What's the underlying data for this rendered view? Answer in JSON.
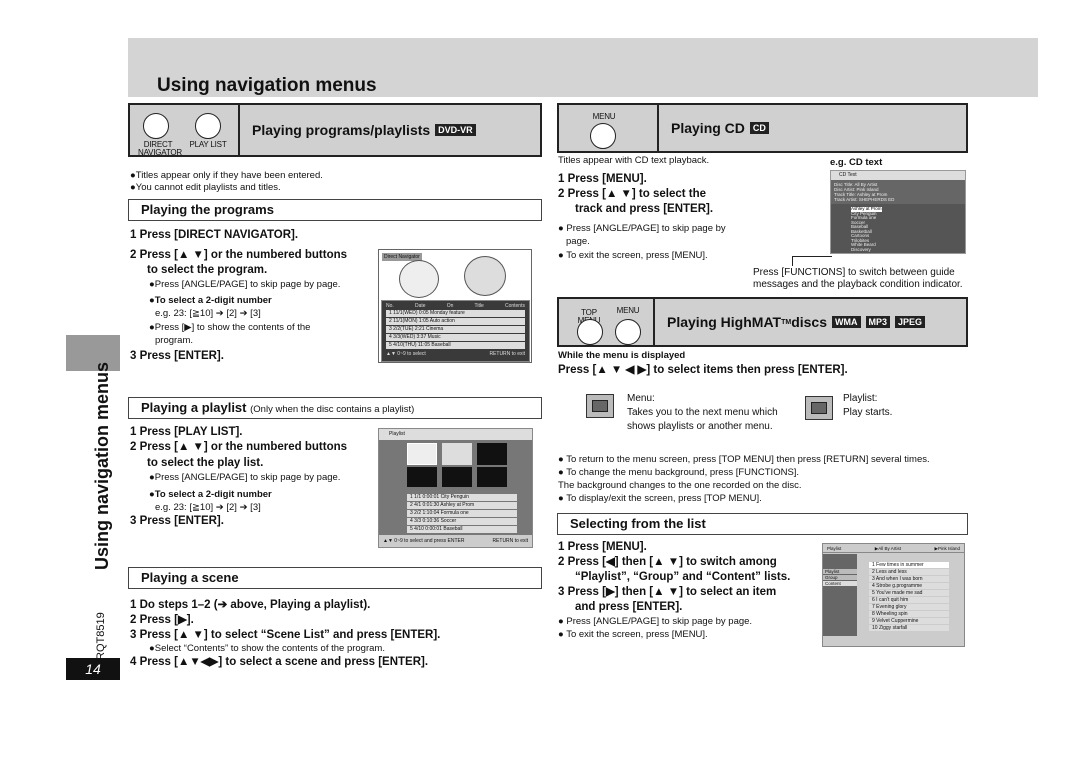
{
  "page": {
    "title": "Using navigation menus",
    "side_label": "Using navigation menus",
    "doc_code": "RQT8519",
    "page_number": "14"
  },
  "programs": {
    "header": "Playing programs/playlists",
    "tag": "DVD-VR",
    "btn1": "DIRECT NAVIGATOR",
    "btn2": "PLAY LIST",
    "notes": [
      "●Titles appear only if they have been entered.",
      "●You cannot edit playlists and titles."
    ],
    "sub": "Playing the programs",
    "step1": "1   Press [DIRECT NAVIGATOR].",
    "step2a": "2   Press [▲ ▼] or the numbered buttons",
    "step2b": "to select the program.",
    "note_page": "●Press [ANGLE/PAGE] to skip page by page.",
    "twodigit": "●To select a 2-digit number",
    "eg": "e.g. 23: [≧10] ➔ [2] ➔ [3]",
    "show1": "●Press [▶] to show the contents of the",
    "show2": "program.",
    "step3": "3   Press [ENTER].",
    "screen": {
      "title": "Direct Navigator",
      "cols": [
        "No.",
        "Date",
        "On",
        "Title",
        "Contents"
      ],
      "rows": [
        "1   11/1(WED)   0:05   Monday feature",
        "2   11/1(MON)   1:05   Auto action",
        "3   2/2(TUE)   2:21   Cinema",
        "4   3/3(WED)   3:37   Music",
        "5   4/10(THU)   11:05   Baseball"
      ],
      "footer": "▲▼ 0~9 to select",
      "exit": "RETURN to exit"
    }
  },
  "playlist": {
    "sub": "Playing a playlist",
    "sub_note": "(Only when the disc contains a playlist)",
    "step1": "1   Press [PLAY LIST].",
    "step2a": "2   Press [▲ ▼] or the numbered buttons",
    "step2b": "to select the play list.",
    "note_page": "●Press [ANGLE/PAGE] to skip page by page.",
    "twodigit": "●To select a 2-digit number",
    "eg": "e.g. 23: [≧10] ➔ [2] ➔ [3]",
    "step3": "3   Press [ENTER].",
    "screen": {
      "title": "Playlist",
      "rows": [
        "1  1/1  0:00:01  City Penguin",
        "2  4/1  0:01:30  Ashley at Prom",
        "3  2/2  1:10:04  Formula one",
        "4  3/3  0:10:36  Soccer",
        "5  4/10  0:00:01  Baseball"
      ],
      "footer": "▲▼ 0~9 to select and press ENTER",
      "exit": "RETURN to exit"
    }
  },
  "scene": {
    "sub": "Playing a scene",
    "steps": [
      "1   Do steps 1–2 (➔ above, Playing a playlist).",
      "2   Press [▶].",
      "3   Press [▲ ▼] to select “Scene List” and press [ENTER].",
      "4   Press [▲▼◀▶] to select a scene and press [ENTER]."
    ],
    "note": "●Select “Contents” to show the contents of the program."
  },
  "cd": {
    "header": "Playing CD",
    "tag": "CD",
    "btn": "MENU",
    "intro": "Titles appear with CD text playback.",
    "eg": "e.g. CD text",
    "step1": "1   Press [MENU].",
    "step2a": "2   Press [▲ ▼] to select the",
    "step2b": "track and press [ENTER].",
    "note1a": "● Press [ANGLE/PAGE] to skip page by",
    "note1b": "page.",
    "note2": "● To exit the screen, press [MENU].",
    "callout1": "Press [FUNCTIONS] to switch between guide",
    "callout2": "messages and the playback condition indicator.",
    "screen": {
      "title": "CD Text",
      "info": [
        "Disc Title:  All By Artist",
        "Disc Artist:  Pink Island",
        "Track Title:  Ashley at Prom",
        "Track Artist:  SHEPHERDS ED"
      ],
      "tracks": [
        "Ashley at Prom",
        "City Penguin",
        "Formula one",
        "Soccer",
        "Baseball",
        "Basketball",
        "Cartoons",
        "Trilobites",
        "White Beard",
        "Discovery"
      ]
    }
  },
  "highmat": {
    "header": "Playing HighMAT",
    "tm": "TM",
    "header2": " discs",
    "tags": [
      "WMA",
      "MP3",
      "JPEG"
    ],
    "btn1": "TOP MENU",
    "btn2": "MENU",
    "while": "While the menu is displayed",
    "press": "Press [▲ ▼ ◀ ▶] to select items then press [ENTER].",
    "menu_l1": "Menu:",
    "menu_l2": "Takes you to the next menu which",
    "menu_l3": "shows playlists or another menu.",
    "pl_l1": "Playlist:",
    "pl_l2": "Play starts.",
    "notes": [
      "● To return to the menu screen, press [TOP MENU] then press [RETURN] several times.",
      "● To change the menu background, press [FUNCTIONS].",
      "   The background changes to the one recorded on the disc.",
      "● To display/exit the screen, press [TOP MENU]."
    ]
  },
  "select": {
    "sub": "Selecting from the list",
    "step1": "1   Press [MENU].",
    "step2a": "2   Press [◀] then [▲ ▼] to switch among",
    "step2b": "“Playlist”, “Group” and “Content” lists.",
    "step3a": "3   Press [▶] then [▲ ▼] to select an item",
    "step3b": "and press [ENTER].",
    "note1": "● Press [ANGLE/PAGE] to skip page by page.",
    "note2": "● To exit the screen, press [MENU].",
    "screen": {
      "title": "Playlist",
      "artist": "▶All By Artist",
      "group": "▶Pink Island",
      "tabs": [
        "Playlist",
        "Group",
        "Content"
      ],
      "rows": [
        "1  Few times in summer",
        "2  Less and less",
        "3  And when I was born",
        "4  Strobe g.programme",
        "5  You've made me sad",
        "6  I can't quit him",
        "7  Evening glory",
        "8  Wheeling spin",
        "9  Velvet Cuppermine",
        "10  Ziggy starfall"
      ]
    }
  }
}
